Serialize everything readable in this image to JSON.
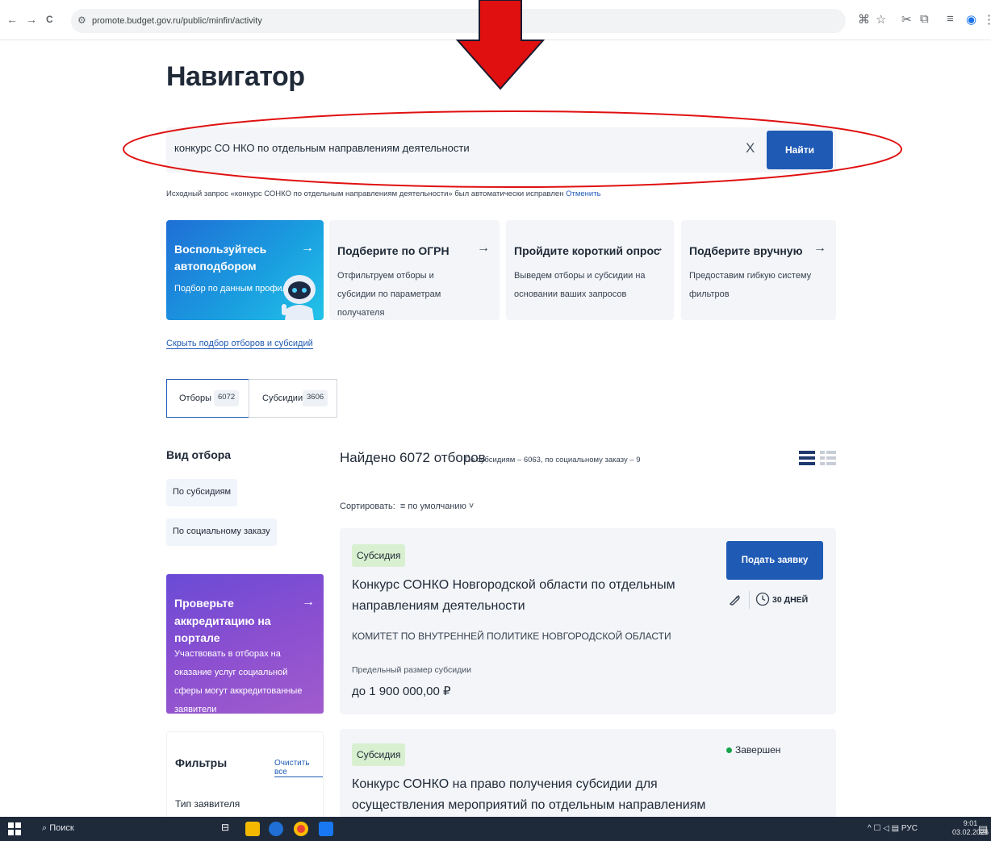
{
  "browser": {
    "back": "←",
    "forward": "→",
    "reload": "C",
    "url": "promote.budget.gov.ru/public/minfin/activity"
  },
  "page": {
    "title": "Навигатор",
    "search": {
      "value": "конкурс СО НКО по отдельным направлениям деятельности",
      "clear": "X",
      "button": "Найти"
    },
    "corrected_note": "Исходный запрос «конкурс СОНКО по отдельным направлениям деятельности» был автоматически исправлен",
    "corrected_cancel": "Отменить",
    "cards": [
      {
        "title": "Воспользуйтесь автоподбором",
        "desc": "Подбор по данным профиля"
      },
      {
        "title": "Подберите по ОГРН",
        "desc": "Отфильтруем отборы и субсидии по параметрам получателя"
      },
      {
        "title": "Пройдите короткий опрос",
        "desc": "Выведем отборы и субсидии на основании ваших запросов"
      },
      {
        "title": "Подберите вручную",
        "desc": "Предоставим гибкую систему фильтров"
      }
    ],
    "hide_link": "Скрыть подбор отборов и субсидий",
    "tabs": [
      {
        "label": "Отборы",
        "count": "6072"
      },
      {
        "label": "Субсидии",
        "count": "3606"
      }
    ],
    "sidebar": {
      "heading": "Вид отбора",
      "chips": [
        "По субсидиям",
        "По социальному заказу"
      ],
      "accreditation": {
        "title": "Проверьте аккредитацию на портале",
        "desc": "Участвовать в отборах на оказание услуг социальной сферы могут аккредитованные заявители"
      },
      "filters": {
        "title": "Фильтры",
        "clear": "Очистить все",
        "applicant_type": "Тип заявителя"
      }
    },
    "results": {
      "found": "Найдено 6072 отборов",
      "found_sub": "По субсидиям – 6063, по социальному заказу – 9",
      "sort_label": "Сортировать:",
      "sort_value": "по умолчанию",
      "items": [
        {
          "badge": "Субсидия",
          "title": "Конкурс СОНКО Новгородской области по отдельным направлениям деятельности",
          "org": "КОМИТЕТ ПО ВНУТРЕННЕЙ ПОЛИТИКЕ НОВГОРОДСКОЙ ОБЛАСТИ",
          "limit_label": "Предельный размер субсидии",
          "limit": "до 1 900 000,00 ₽",
          "apply": "Подать заявку",
          "days": "30 ДНЕЙ"
        },
        {
          "badge": "Субсидия",
          "title": "Конкурс СОНКО на право получения субсидии для осуществления мероприятий по отдельным направлениям деятельности",
          "status": "Завершен"
        }
      ]
    }
  },
  "taskbar": {
    "search": "Поиск",
    "lang": "РУС",
    "time": "9:01",
    "date": "03.02.2026"
  },
  "colors": {
    "primary": "#1f5bb5",
    "annotation": "#e01010",
    "badge": "#d9f0d0",
    "status_done": "#16a34a"
  }
}
